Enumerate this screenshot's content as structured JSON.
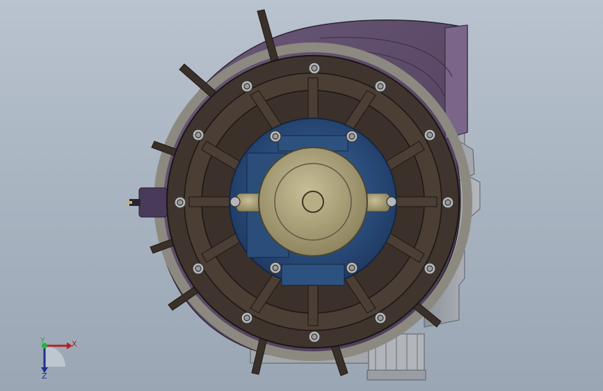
{
  "app": {
    "view": "cad-model-viewport"
  },
  "triad": {
    "x_label": "X",
    "y_label": "Y",
    "z_label": "Z"
  },
  "colors": {
    "background_top": "#b9c3cf",
    "background_bottom": "#9aa6b4",
    "volute": "#5e4a6b",
    "casing": "#3f352e",
    "hub_blue": "#2c4f7e",
    "bearing": "#a9a07a",
    "bolt": "#b7b7b7"
  },
  "icons": {
    "triad": "coordinate-triad-icon"
  }
}
